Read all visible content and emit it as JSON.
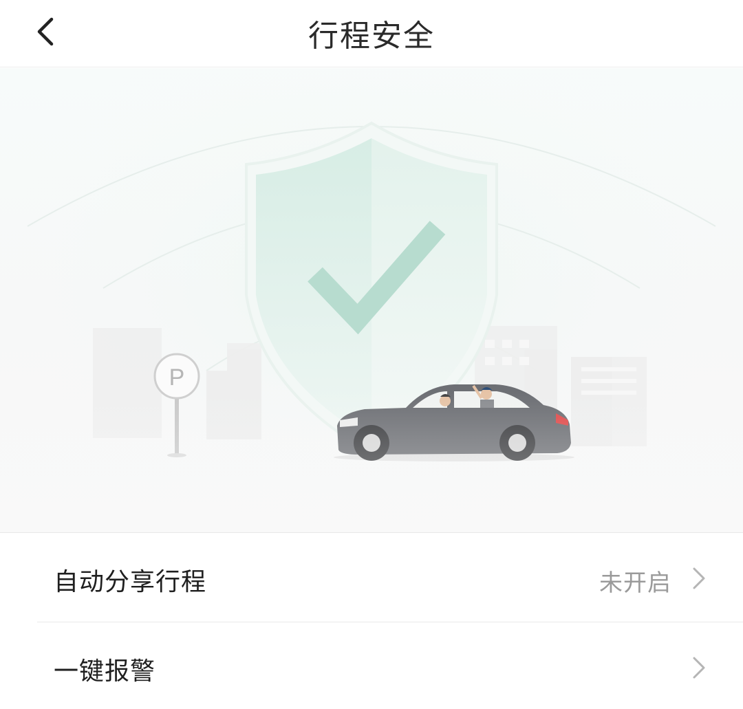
{
  "header": {
    "title": "行程安全",
    "back_icon": "chevron-left-icon"
  },
  "hero": {
    "shield_icon": "shield-check-icon",
    "parking_sign_letter": "P",
    "colors": {
      "shield": "#dcefe8",
      "check": "#b8ddd0",
      "car_body": "#6d6f74",
      "tail_light": "#e04a4a"
    }
  },
  "settings": {
    "items": [
      {
        "label": "自动分享行程",
        "value": "未开启",
        "icon": "chevron-right-icon"
      },
      {
        "label": "一键报警",
        "value": "",
        "icon": "chevron-right-icon"
      }
    ]
  }
}
